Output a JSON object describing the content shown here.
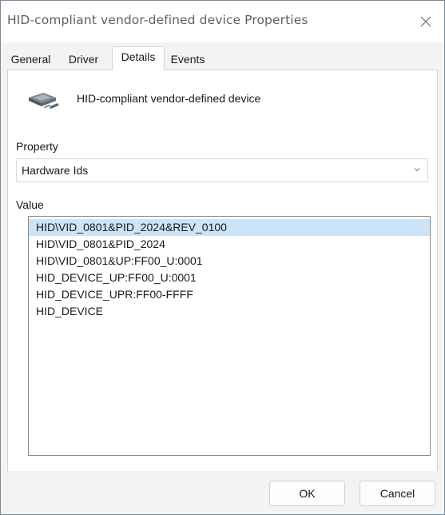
{
  "window": {
    "title": "HID-compliant vendor-defined device Properties",
    "close_icon": "close-icon"
  },
  "tabs": [
    {
      "label": "General",
      "active": false
    },
    {
      "label": "Driver",
      "active": false
    },
    {
      "label": "Details",
      "active": true
    },
    {
      "label": "Events",
      "active": false
    }
  ],
  "details": {
    "device_icon": "hid-device-icon",
    "device_name": "HID-compliant vendor-defined device",
    "property_label": "Property",
    "property_selected": "Hardware Ids",
    "value_label": "Value",
    "values": [
      "HID\\VID_0801&PID_2024&REV_0100",
      "HID\\VID_0801&PID_2024",
      "HID\\VID_0801&UP:FF00_U:0001",
      "HID_DEVICE_UP:FF00_U:0001",
      "HID_DEVICE_UPR:FF00-FFFF",
      "HID_DEVICE"
    ],
    "selected_index": 0
  },
  "buttons": {
    "ok_label": "OK",
    "cancel_label": "Cancel"
  },
  "colors": {
    "selection": "#cce4f7",
    "window_bg": "#f3f3f3"
  }
}
